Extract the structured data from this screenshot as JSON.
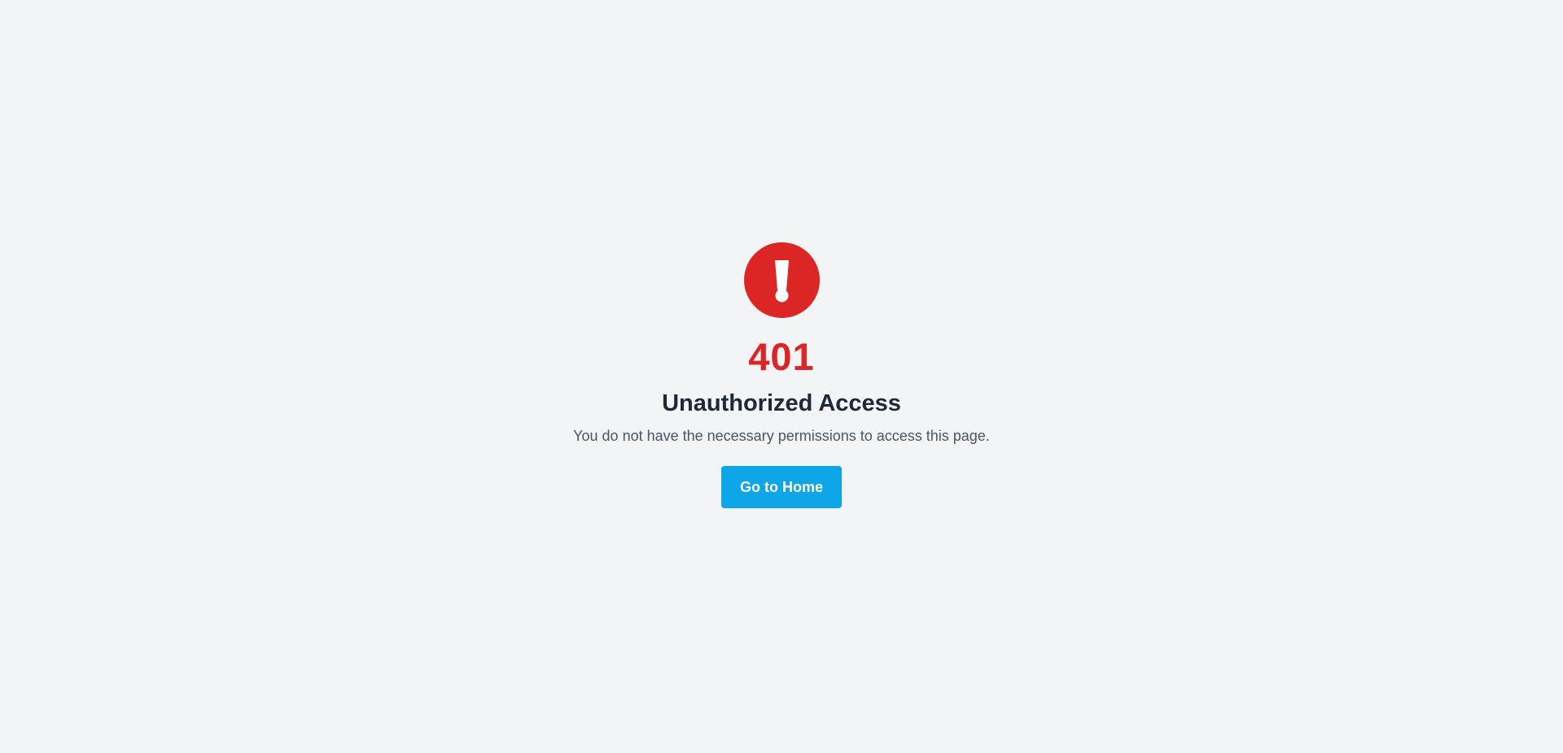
{
  "error": {
    "icon": "exclamation-circle-icon",
    "code": "401",
    "title": "Unauthorized Access",
    "message": "You do not have the necessary permissions to access this page."
  },
  "actions": {
    "home_label": "Go to Home"
  },
  "colors": {
    "background": "#f3f4f6",
    "error_red": "#dc2626",
    "title_text": "#1f2937",
    "body_text": "#4b5563",
    "button_bg": "#0ea5e9",
    "button_text": "#ffffff"
  }
}
